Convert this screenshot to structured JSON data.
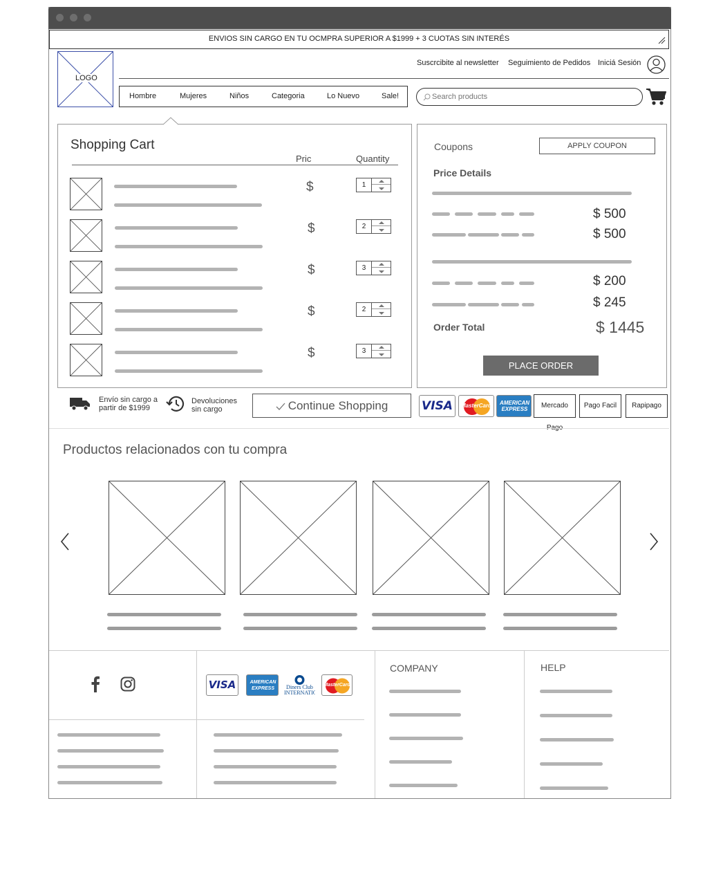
{
  "banner": {
    "text": "ENVIOS SIN CARGO EN TU OCMPRA SUPERIOR A $1999 + 3 CUOTAS SIN INTERÉS"
  },
  "header": {
    "logo_text": "LOGO",
    "links": [
      "Suscrcibite al newsletter",
      "Seguimiento de Pedidos",
      "Iniciá Sesión"
    ],
    "nav": [
      "Hombre",
      "Mujeres",
      "Niños",
      "Categoria",
      "Lo Nuevo",
      "Sale!"
    ],
    "search_placeholder": "Search products"
  },
  "cart": {
    "title": "Shopping Cart",
    "col_price": "Pric",
    "col_price_tail": "-",
    "col_quantity": "Quantity",
    "items": [
      {
        "price": "$",
        "qty": "1"
      },
      {
        "price": "$",
        "qty": "2"
      },
      {
        "price": "$",
        "qty": "3"
      },
      {
        "price": "$",
        "qty": "2"
      },
      {
        "price": "$",
        "qty": "3"
      }
    ]
  },
  "summary": {
    "coupons_label": "Coupons",
    "apply_coupon": "APPLY COUPON",
    "price_details": "Price Details",
    "amounts": [
      "$ 500",
      "$ 500",
      "$ 200",
      "$ 245"
    ],
    "order_total_label": "Order Total",
    "order_total": "$ 1445",
    "place_order": "PLACE ORDER"
  },
  "benefits": {
    "shipping": "Envío sin cargo a partir de $1999",
    "returns": "Devoluciones sin cargo"
  },
  "continue_shopping": "Continue Shopping",
  "payment_cards": [
    "VISA",
    "MasterCard",
    "AMERICAN EXPRESS"
  ],
  "payment_methods": [
    "Mercado Pago",
    "Pago Facil",
    "Rapipago"
  ],
  "related": {
    "title": "Productos relacionados con tu compra"
  },
  "footer": {
    "cards": [
      "VISA",
      "AMERICAN EXPRESS",
      "Diners Club INTERNATIONAL",
      "MasterCard"
    ],
    "company": "COMPANY",
    "help": "HELP"
  },
  "colors": {
    "chrome": "#4d4d4d",
    "button": "#6b6b6b",
    "logo_border": "#3b4fa8",
    "placeholder_line": "#b3b3b3"
  },
  "icons": [
    "user-icon",
    "cart-icon",
    "search-icon",
    "truck-icon",
    "history-icon",
    "check-icon",
    "chevron-left-icon",
    "chevron-right-icon",
    "facebook-icon",
    "instagram-icon",
    "resize-icon"
  ]
}
